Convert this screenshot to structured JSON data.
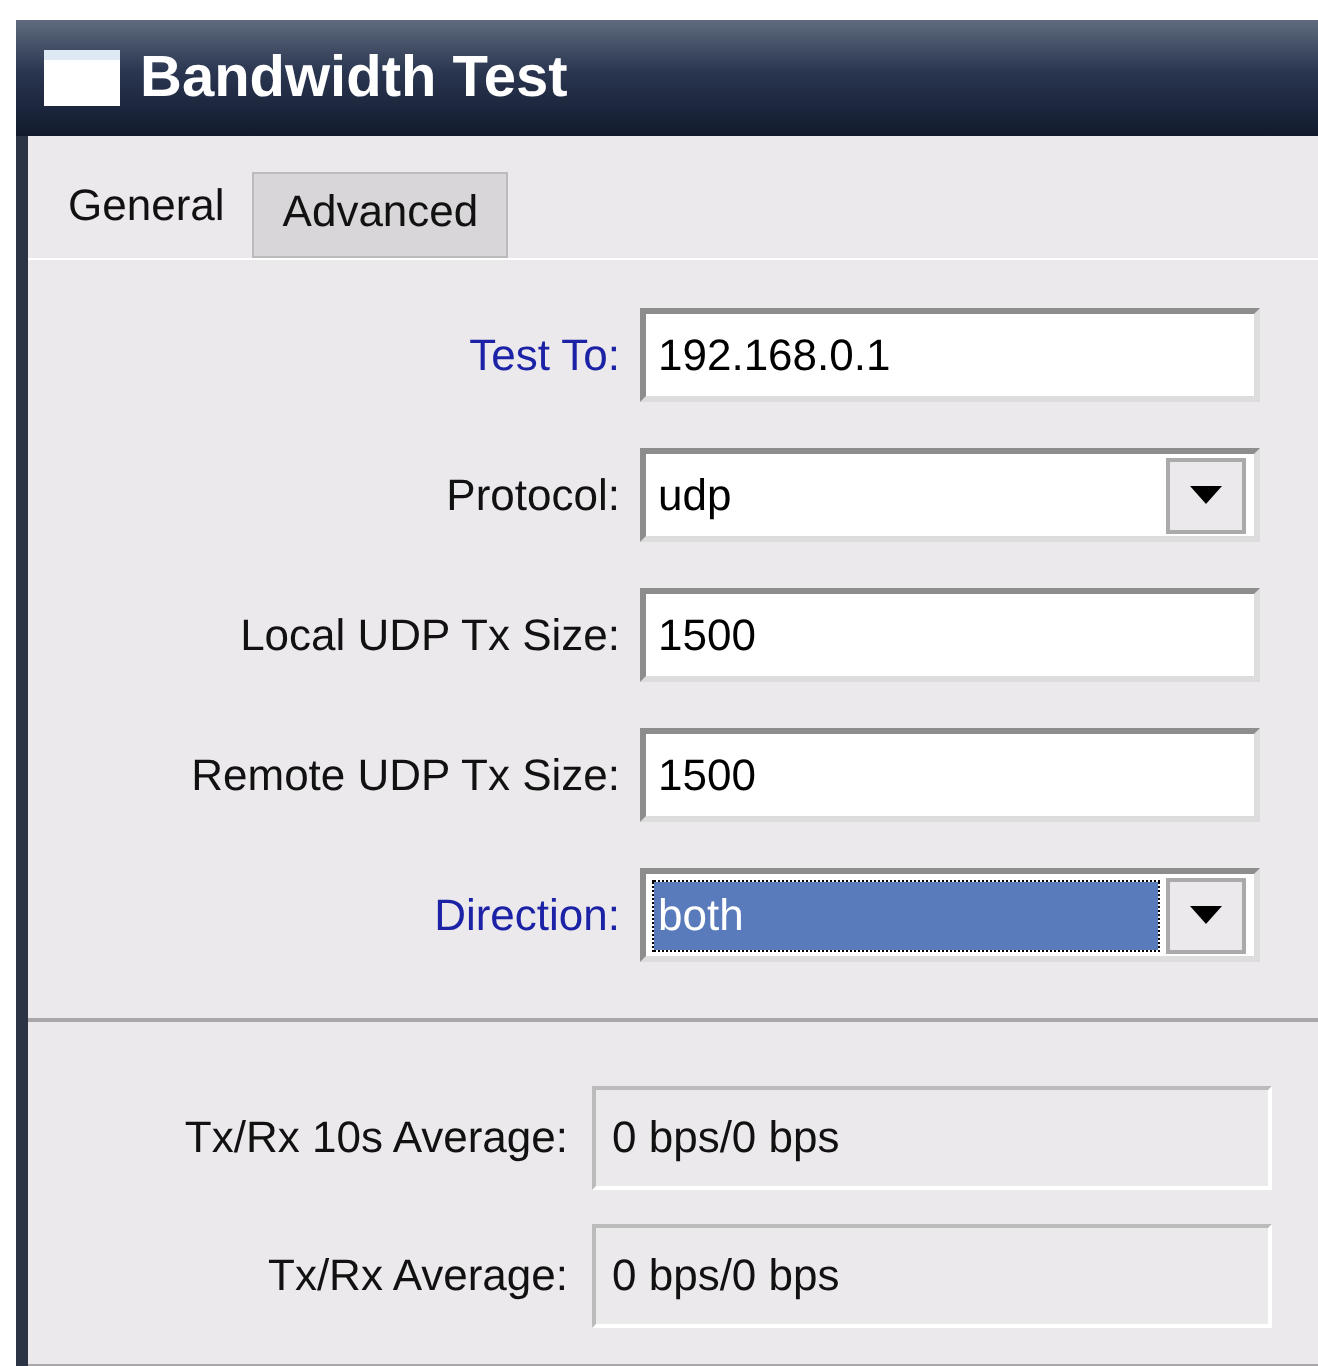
{
  "window": {
    "title": "Bandwidth Test"
  },
  "tabs": [
    {
      "label": "General",
      "selected": true
    },
    {
      "label": "Advanced",
      "selected": false
    }
  ],
  "fields": [
    {
      "label": "Test To:",
      "highlighted": true,
      "kind": "text",
      "value": "192.168.0.1",
      "focused": false
    },
    {
      "label": "Protocol:",
      "highlighted": false,
      "kind": "dropdown",
      "value": "udp",
      "focused": false
    },
    {
      "label": "Local UDP Tx Size:",
      "highlighted": false,
      "kind": "text",
      "value": "1500",
      "focused": false
    },
    {
      "label": "Remote UDP Tx Size:",
      "highlighted": false,
      "kind": "text",
      "value": "1500",
      "focused": false
    },
    {
      "label": "Direction:",
      "highlighted": true,
      "kind": "dropdown",
      "value": "both",
      "focused": true
    }
  ],
  "readouts": [
    {
      "label": "Tx/Rx 10s Average:",
      "value": "0 bps/0 bps"
    },
    {
      "label": "Tx/Rx Average:",
      "value": "0 bps/0 bps"
    }
  ]
}
